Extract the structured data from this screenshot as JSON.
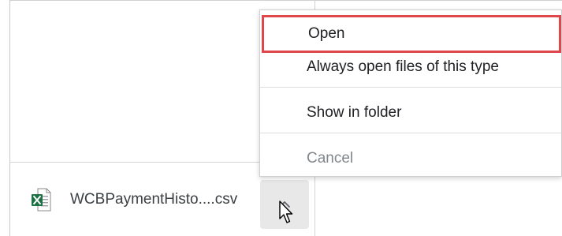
{
  "download_bar": {
    "file_name": "WCBPaymentHisto....csv",
    "file_type_icon": "excel-csv-file-icon",
    "chevron_icon": "chevron-up-icon"
  },
  "context_menu": {
    "items": [
      {
        "label": "Open",
        "highlighted": true,
        "enabled": true
      },
      {
        "label": "Always open files of this type",
        "enabled": true
      },
      {
        "label": "Show in folder",
        "enabled": true
      },
      {
        "label": "Cancel",
        "enabled": false
      }
    ]
  },
  "colors": {
    "highlight_border": "#e0474c",
    "excel_green": "#1e7145",
    "disabled_text": "#80868b",
    "chevron_button_bg": "#e8e8e8"
  }
}
